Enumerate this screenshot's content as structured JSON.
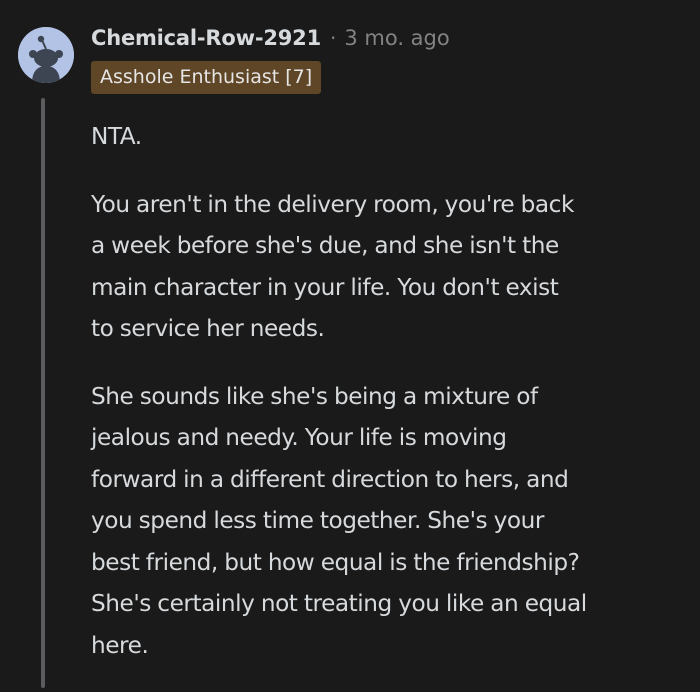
{
  "comment": {
    "username": "Chemical-Row-2921",
    "separator": "·",
    "timestamp": "3 mo. ago",
    "flair": "Asshole Enthusiast [7]",
    "avatar_icon": "reddit-snoo-avatar-icon",
    "paragraphs": [
      [
        "NTA."
      ],
      [
        "You aren't in the delivery room, you're back",
        "a week before she's due, and she isn't the",
        "main character in your life. You don't exist",
        "to service her needs."
      ],
      [
        "She sounds like she's being a mixture of",
        "jealous and needy. Your life is moving",
        "forward in a different direction to hers, and",
        "you spend less time together. She's your",
        "best friend, but how equal is the friendship?",
        "She's certainly not treating you like an equal",
        "here."
      ]
    ]
  },
  "colors": {
    "background": "#1a1a1b",
    "text": "#d7dadc",
    "muted": "#818384",
    "flair_bg": "#5f4626",
    "avatar_bg": "#b3c3e6",
    "thread_line": "#5c5c5e"
  }
}
